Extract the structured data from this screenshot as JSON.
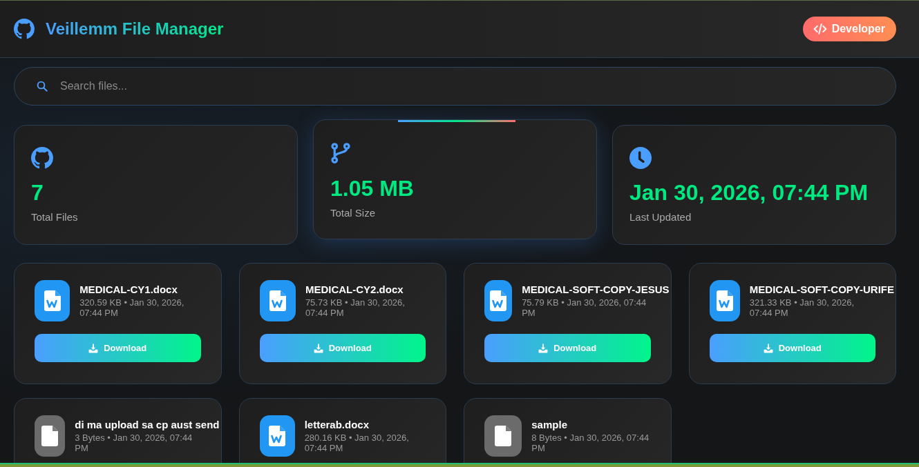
{
  "header": {
    "title": "Veillemm File Manager",
    "developer_button": "Developer"
  },
  "search": {
    "placeholder": "Search files..."
  },
  "stats": [
    {
      "kind": "files",
      "value": "7",
      "label": "Total Files",
      "highlighted": false
    },
    {
      "kind": "size",
      "value": "1.05 MB",
      "label": "Total Size",
      "highlighted": true
    },
    {
      "kind": "updated",
      "value": "Jan 30, 2026, 07:44 PM",
      "label": "Last Updated",
      "highlighted": false
    }
  ],
  "files": [
    {
      "kind": "word",
      "name": "MEDICAL-CY1.docx",
      "meta": "320.59 KB • Jan 30, 2026, 07:44 PM",
      "button": "Download"
    },
    {
      "kind": "word",
      "name": "MEDICAL-CY2.docx",
      "meta": "75.73 KB • Jan 30, 2026, 07:44 PM",
      "button": "Download"
    },
    {
      "kind": "word",
      "name": "MEDICAL-SOFT-COPY-JESUS",
      "meta": "75.79 KB • Jan 30, 2026, 07:44 PM",
      "button": "Download"
    },
    {
      "kind": "word",
      "name": "MEDICAL-SOFT-COPY-URIFE",
      "meta": "321.33 KB • Jan 30, 2026, 07:44 PM",
      "button": "Download"
    },
    {
      "kind": "generic",
      "name": "di ma upload sa cp aust send",
      "meta": "3 Bytes • Jan 30, 2026, 07:44 PM"
    },
    {
      "kind": "word",
      "name": "letterab.docx",
      "meta": "280.16 KB • Jan 30, 2026, 07:44 PM"
    },
    {
      "kind": "generic",
      "name": "sample",
      "meta": "8 Bytes • Jan 30, 2026, 07:44 PM"
    }
  ]
}
